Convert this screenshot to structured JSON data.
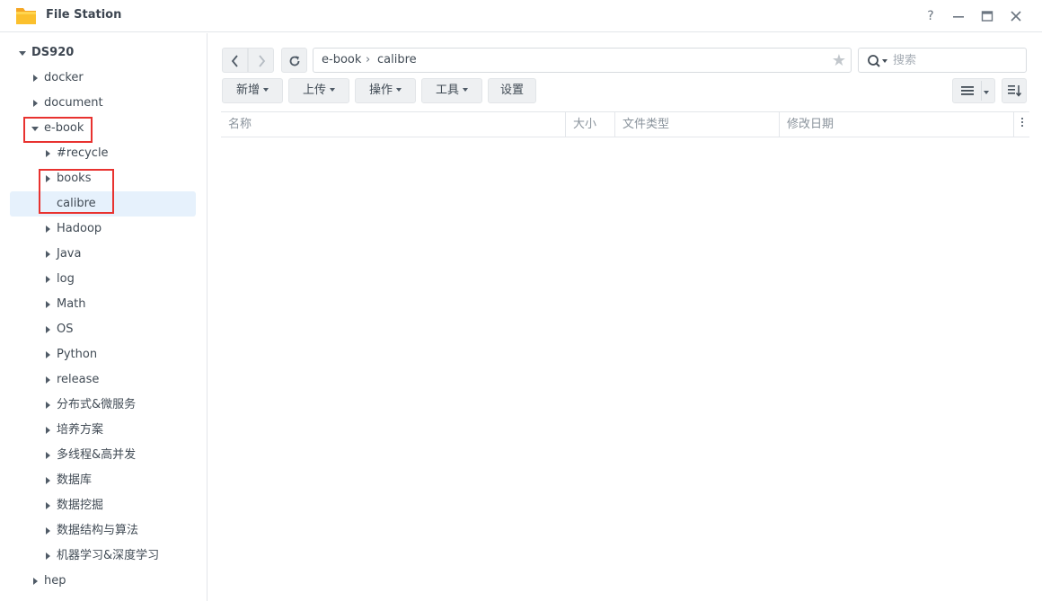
{
  "window": {
    "title": "File Station",
    "help_label": "?",
    "accent": "#f6a623"
  },
  "sidebar": {
    "root": "DS920",
    "items": [
      {
        "label": "docker"
      },
      {
        "label": "document"
      },
      {
        "label": "e-book"
      },
      {
        "label": "#recycle"
      },
      {
        "label": "books"
      },
      {
        "label": "calibre"
      },
      {
        "label": "Hadoop"
      },
      {
        "label": "Java"
      },
      {
        "label": "log"
      },
      {
        "label": "Math"
      },
      {
        "label": "OS"
      },
      {
        "label": "Python"
      },
      {
        "label": "release"
      },
      {
        "label": "分布式&微服务"
      },
      {
        "label": "培养方案"
      },
      {
        "label": "多线程&高并发"
      },
      {
        "label": "数据库"
      },
      {
        "label": "数据挖掘"
      },
      {
        "label": "数据结构与算法"
      },
      {
        "label": "机器学习&深度学习"
      },
      {
        "label": "hep"
      }
    ]
  },
  "path": {
    "segments": [
      "e-book",
      "calibre"
    ],
    "separator": "›",
    "star": "★"
  },
  "search": {
    "placeholder": "搜索"
  },
  "toolbar": {
    "new_label": "新增",
    "upload_label": "上传",
    "action_label": "操作",
    "tools_label": "工具",
    "settings_label": "设置"
  },
  "table": {
    "columns": [
      "名称",
      "大小",
      "文件类型",
      "修改日期"
    ]
  },
  "highlight_color": "#e8322f"
}
